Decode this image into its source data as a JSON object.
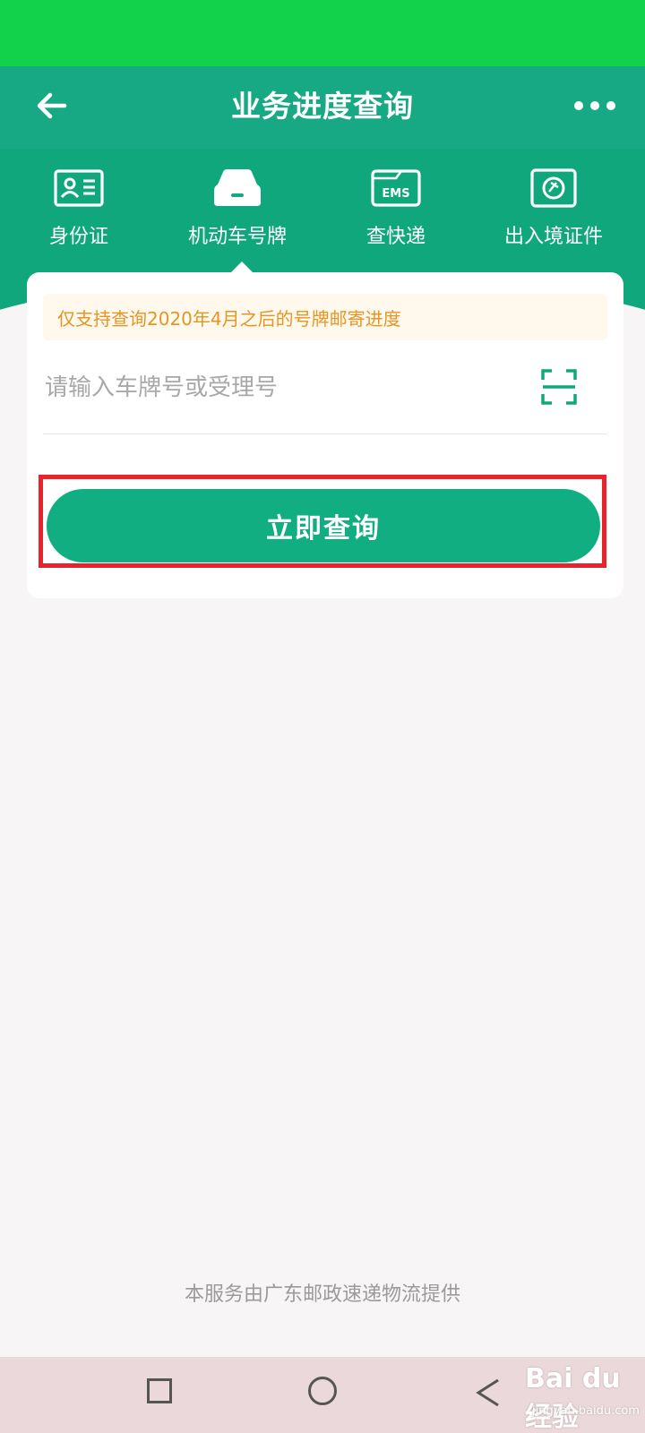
{
  "header": {
    "title": "业务进度查询",
    "back_icon": "arrow-left-icon",
    "more_icon": "more-dots-icon"
  },
  "tabs": [
    {
      "label": "身份证",
      "icon": "id-card-icon"
    },
    {
      "label": "机动车号牌",
      "icon": "car-icon",
      "active": true
    },
    {
      "label": "查快递",
      "icon": "ems-icon",
      "icon_text": "EMS"
    },
    {
      "label": "出入境证件",
      "icon": "passport-icon"
    }
  ],
  "card": {
    "notice": "仅支持查询2020年4月之后的号牌邮寄进度",
    "input_placeholder": "请输入车牌号或受理号",
    "input_value": "",
    "scan_icon": "scan-icon",
    "query_button": "立即查询"
  },
  "footer": {
    "provider_note": "本服务由广东邮政速递物流提供"
  },
  "watermark": {
    "logo": "Bai du 经验",
    "sub": "jingyan.baidu.com"
  },
  "colors": {
    "status_bar": "#12d14a",
    "header_green": "#11a77d",
    "button_green": "#11ae82",
    "notice_text": "#e69524",
    "highlight_red": "#e8232b"
  }
}
